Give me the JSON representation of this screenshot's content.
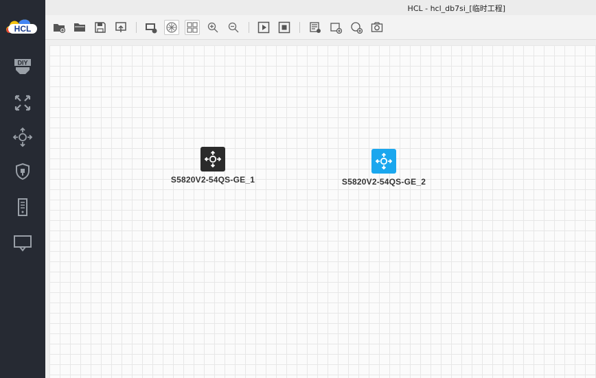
{
  "window": {
    "title": "HCL - hcl_db7si_[临时工程]"
  },
  "logo": {
    "text": "HCL"
  },
  "sidebar": {
    "items": [
      {
        "name": "diy-device",
        "icon": "diy-icon",
        "text": "DIY"
      },
      {
        "name": "router",
        "icon": "router-icon"
      },
      {
        "name": "switch",
        "icon": "switch-icon"
      },
      {
        "name": "firewall",
        "icon": "shield-icon"
      },
      {
        "name": "server",
        "icon": "server-icon"
      },
      {
        "name": "terminal",
        "icon": "terminal-icon"
      }
    ]
  },
  "toolbar": {
    "buttons": [
      "new-project-icon",
      "open-folder-icon",
      "save-icon",
      "export-icon",
      "topology-icon",
      "hide-grid-icon",
      "grid-icon",
      "zoom-in-icon",
      "zoom-out-icon",
      "start-icon",
      "stop-icon",
      "list-icon",
      "add-note-icon",
      "add-shape-icon",
      "camera-icon"
    ]
  },
  "devices": [
    {
      "label": "S5820V2-54QS-GE_1",
      "status": "stopped",
      "color": "#2b2b2b"
    },
    {
      "label": "S5820V2-54QS-GE_2",
      "status": "running",
      "color": "#1aa7ee"
    }
  ]
}
